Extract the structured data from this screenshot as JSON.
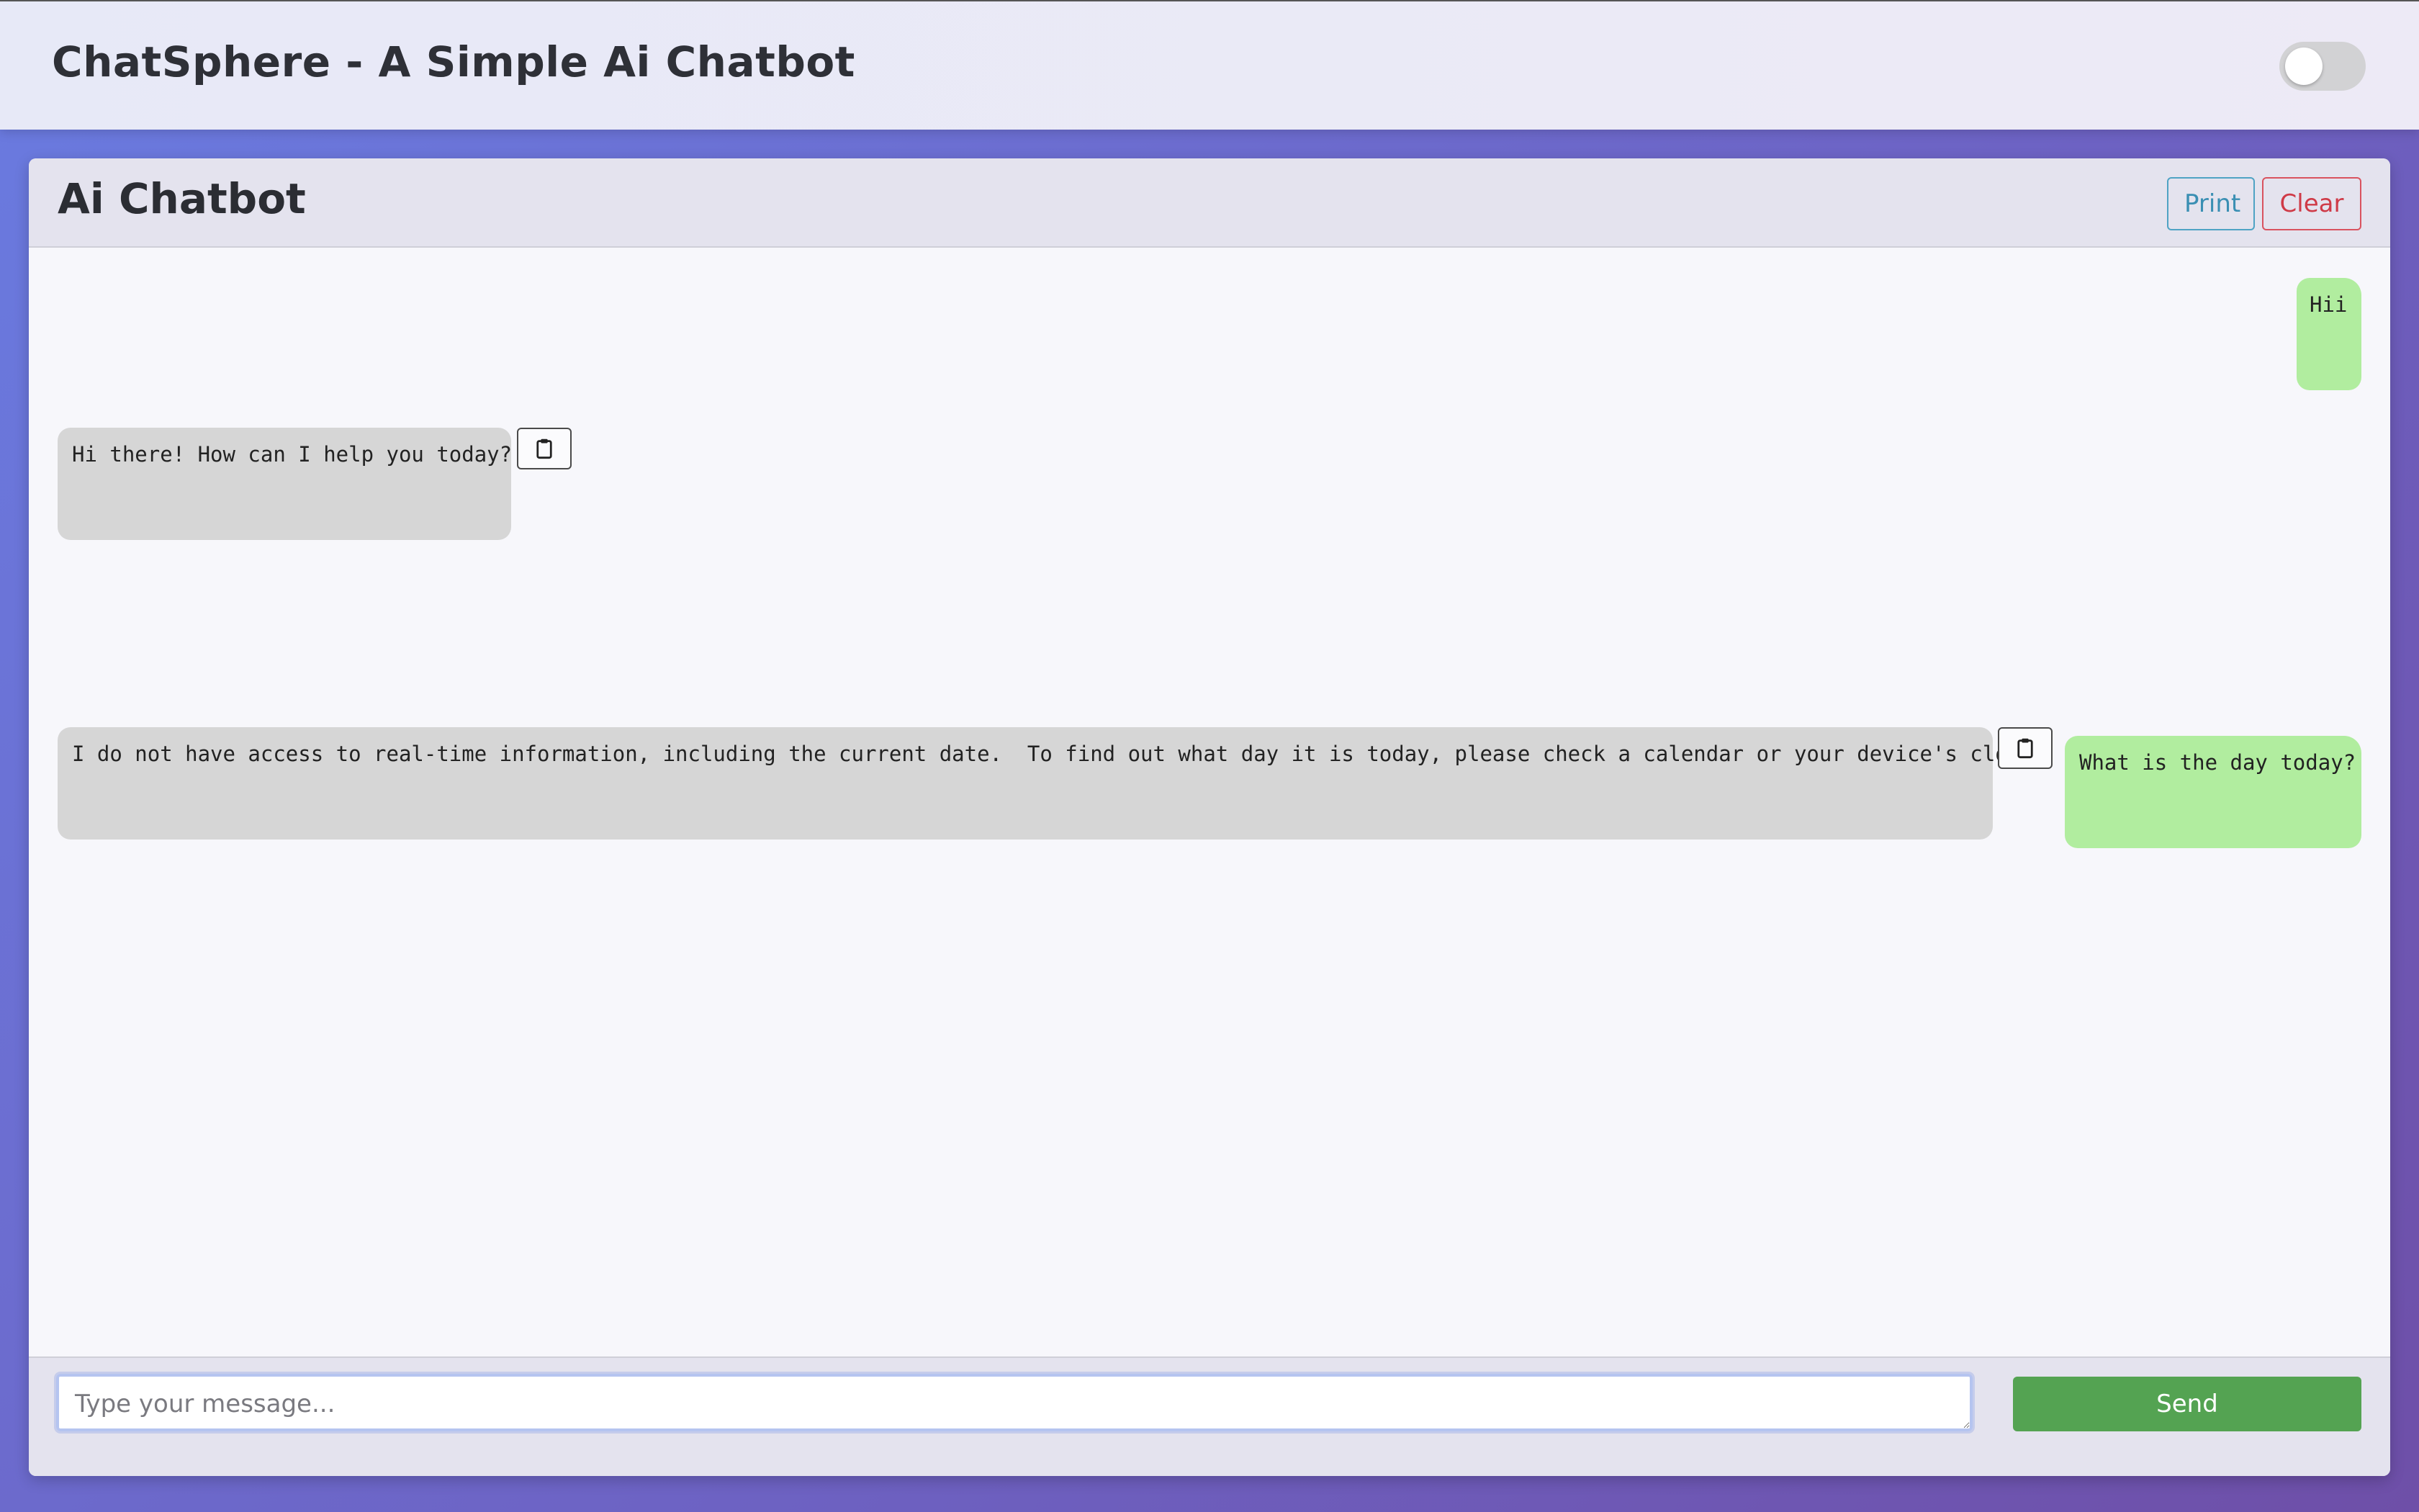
{
  "app": {
    "title": "ChatSphere - A Simple Ai Chatbot",
    "theme_toggle": "off"
  },
  "chat": {
    "title": "Ai Chatbot",
    "print_label": "Print",
    "clear_label": "Clear",
    "messages": [
      {
        "role": "user",
        "text": "Hii"
      },
      {
        "role": "bot",
        "text": "Hi there! How can I help you today?",
        "icon": "clipboard-icon"
      },
      {
        "role": "user",
        "text": "What is the day today?"
      },
      {
        "role": "bot",
        "text": "I do not have access to real-time information, including the current date.  To find out what day it is today, please check a calendar or your device's clock.",
        "icon": "clipboard-icon"
      }
    ]
  },
  "composer": {
    "placeholder": "Type your message...",
    "value": "",
    "send_label": "Send"
  },
  "colors": {
    "user_bubble": "#b1ed9f",
    "bot_bubble": "#d6d6d6",
    "send_button": "#54a352",
    "print_border": "#4fa3c4",
    "clear_border": "#d9535f"
  }
}
